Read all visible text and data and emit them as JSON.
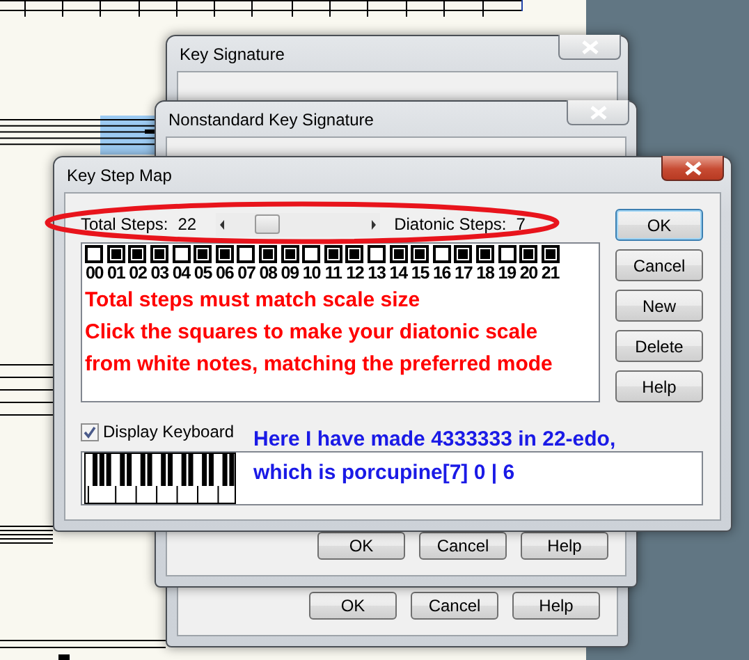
{
  "background_windows": [
    {
      "title": "Key Signature",
      "buttons": [
        "OK",
        "Cancel",
        "Help"
      ]
    },
    {
      "title": "Nonstandard Key Signature",
      "buttons": [
        "OK",
        "Cancel",
        "Help"
      ]
    }
  ],
  "dialog": {
    "title": "Key Step Map",
    "total_steps_label": "Total Steps:",
    "total_steps": "22",
    "diatonic_steps_label": "Diatonic Steps:",
    "diatonic_steps": "7",
    "steps": [
      {
        "label": "00",
        "white_note": true
      },
      {
        "label": "01",
        "white_note": false
      },
      {
        "label": "02",
        "white_note": false
      },
      {
        "label": "03",
        "white_note": false
      },
      {
        "label": "04",
        "white_note": true
      },
      {
        "label": "05",
        "white_note": false
      },
      {
        "label": "06",
        "white_note": false
      },
      {
        "label": "07",
        "white_note": true
      },
      {
        "label": "08",
        "white_note": false
      },
      {
        "label": "09",
        "white_note": false
      },
      {
        "label": "10",
        "white_note": true
      },
      {
        "label": "11",
        "white_note": false
      },
      {
        "label": "12",
        "white_note": false
      },
      {
        "label": "13",
        "white_note": true
      },
      {
        "label": "14",
        "white_note": false
      },
      {
        "label": "15",
        "white_note": false
      },
      {
        "label": "16",
        "white_note": true
      },
      {
        "label": "17",
        "white_note": false
      },
      {
        "label": "18",
        "white_note": false
      },
      {
        "label": "19",
        "white_note": true
      },
      {
        "label": "20",
        "white_note": false
      },
      {
        "label": "21",
        "white_note": false
      }
    ],
    "notes": [
      "Total steps must match scale size",
      "Click the squares to make your diatonic scale",
      "from white notes, matching the preferred mode"
    ],
    "display_keyboard": {
      "label": "Display Keyboard",
      "checked": true
    },
    "buttons": [
      {
        "label": "OK",
        "default": true
      },
      {
        "label": "Cancel",
        "default": false
      },
      {
        "label": "New",
        "default": false
      },
      {
        "label": "Delete",
        "default": false
      },
      {
        "label": "Help",
        "default": false
      }
    ]
  },
  "annotation": [
    "Here I have made 4333333 in 22-edo,",
    "which is porcupine[7] 0 | 6"
  ]
}
